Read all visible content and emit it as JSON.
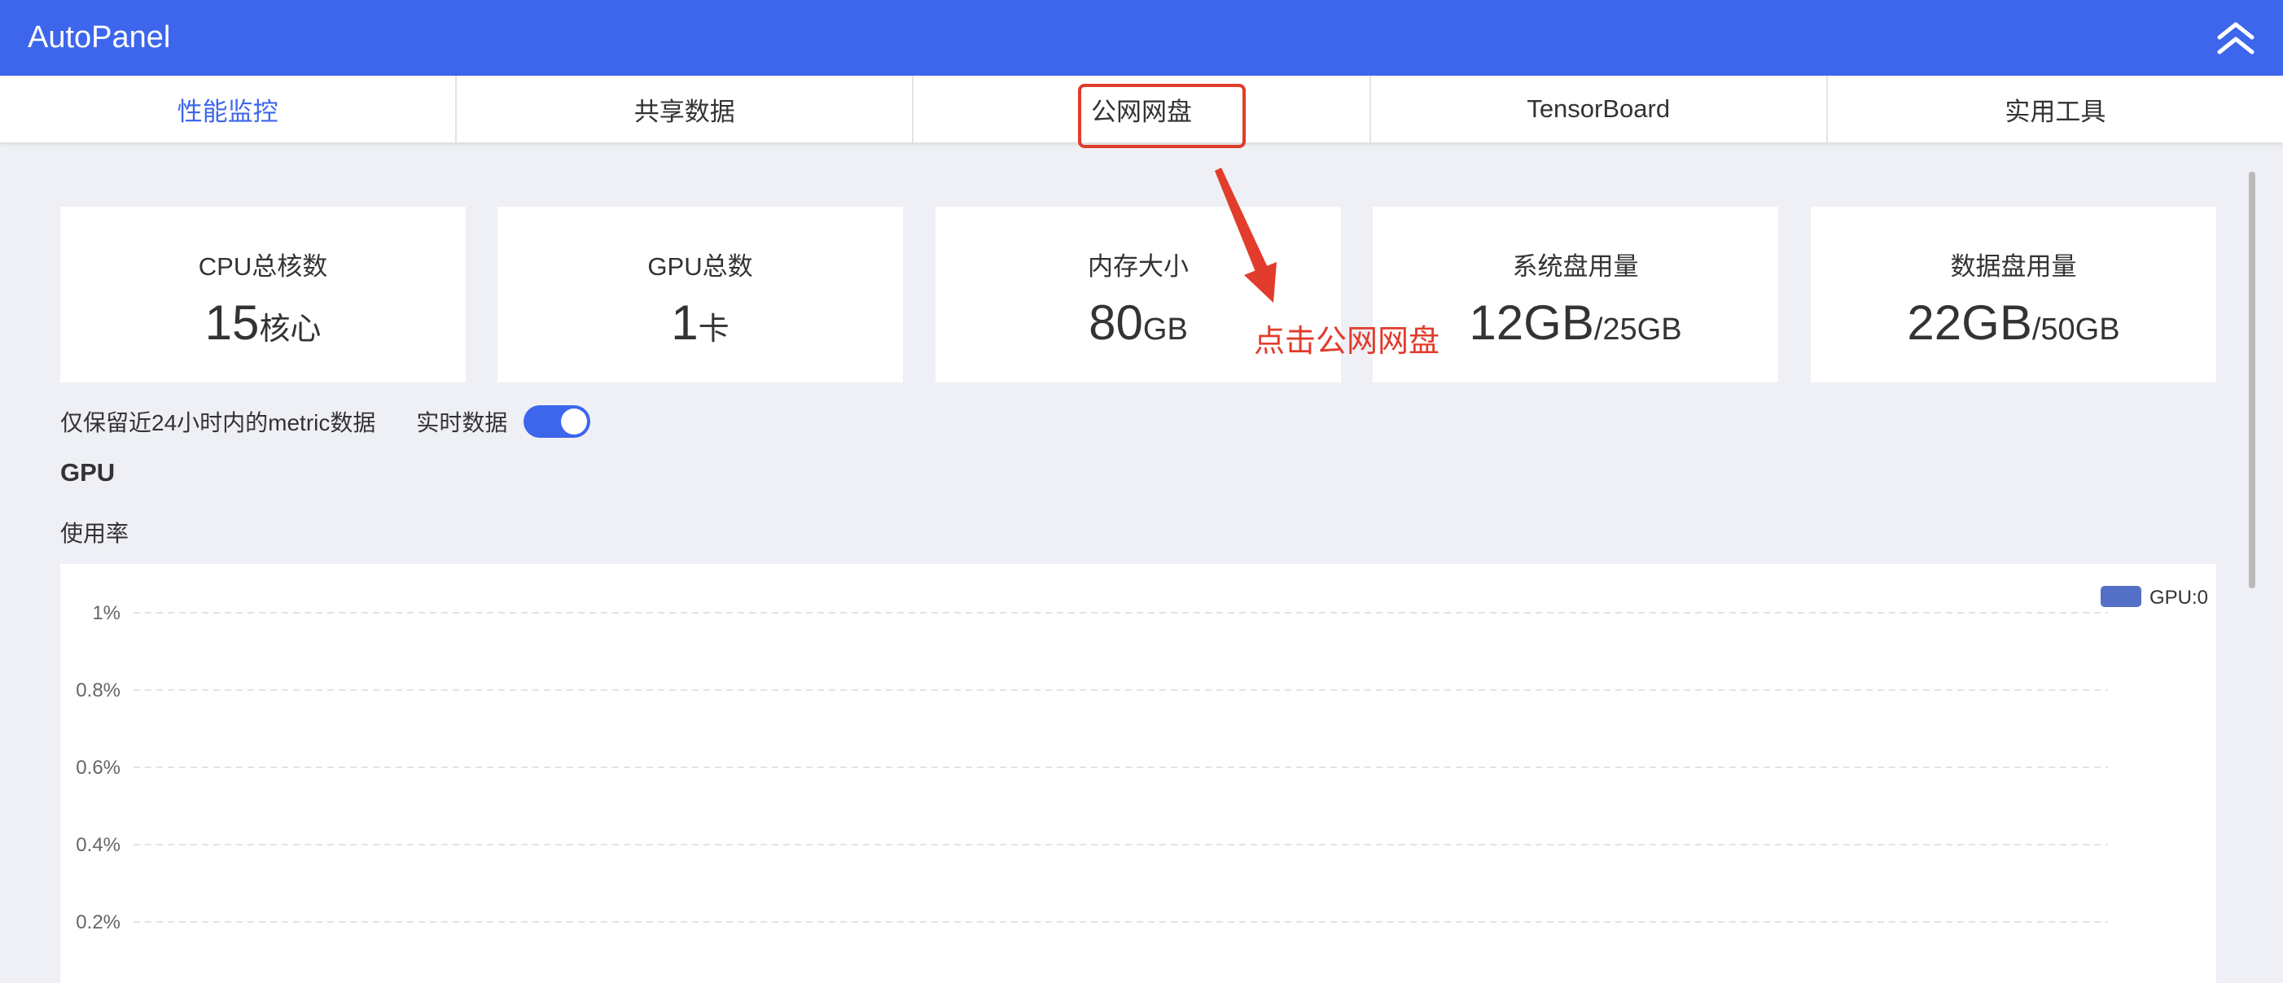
{
  "app": {
    "title": "AutoPanel"
  },
  "header": {
    "collapse_icon": "double-chevron-up-icon"
  },
  "tabs": [
    {
      "label": "性能监控",
      "active": true
    },
    {
      "label": "共享数据",
      "active": false
    },
    {
      "label": "公网网盘",
      "active": false
    },
    {
      "label": "TensorBoard",
      "active": false
    },
    {
      "label": "实用工具",
      "active": false
    }
  ],
  "stats": [
    {
      "label": "CPU总核数",
      "value": "15",
      "unit": "核心"
    },
    {
      "label": "GPU总数",
      "value": "1",
      "unit": "卡"
    },
    {
      "label": "内存大小",
      "value": "80",
      "unit": "GB"
    },
    {
      "label": "系统盘用量",
      "value": "12GB",
      "unit": "/25GB"
    },
    {
      "label": "数据盘用量",
      "value": "22GB",
      "unit": "/50GB"
    }
  ],
  "controls": {
    "retention_note": "仅保留近24小时内的metric数据",
    "realtime_label": "实时数据",
    "realtime_enabled": true
  },
  "section": {
    "title": "GPU",
    "metric_label": "使用率"
  },
  "annotation": {
    "text": "点击公网网盘"
  },
  "colors": {
    "accent": "#3d66ec",
    "series": "#5470c6",
    "annotation": "#e23c2c"
  },
  "chart_data": {
    "type": "line",
    "title": "",
    "xlabel": "",
    "ylabel": "",
    "y_tick_labels": [
      "1%",
      "0.8%",
      "0.6%",
      "0.4%",
      "0.2%"
    ],
    "y_ticks": [
      1,
      0.8,
      0.6,
      0.4,
      0.2
    ],
    "ylim": [
      0,
      1
    ],
    "grid": true,
    "legend": "top-right",
    "series": [
      {
        "name": "GPU:0",
        "values": []
      }
    ]
  }
}
